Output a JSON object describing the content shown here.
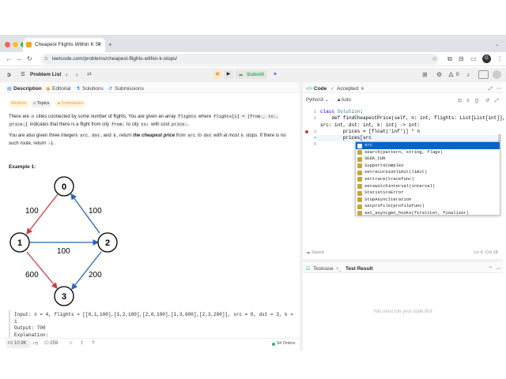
{
  "browser": {
    "tab_title": "Cheapest Flights Within K St",
    "url": "leetcode.com/problems/cheapest-flights-within-k-stops/",
    "profile": "G"
  },
  "nav": {
    "problem_list": "Problem List",
    "submit": "Submit",
    "streak": "0"
  },
  "left_tabs": {
    "description": "Description",
    "editorial": "Editorial",
    "solutions": "Solutions",
    "submissions": "Submissions"
  },
  "problem": {
    "difficulty": "Medium",
    "topics": "Topics",
    "companies": "Companies",
    "p1_a": "There are ",
    "p1_n": "n",
    "p1_b": " cities connected by some number of flights. You are given an array ",
    "p1_flights": "flights",
    "p1_c": " where ",
    "p1_fi": "flights[i] = [fromᵢ, toᵢ,",
    "p1_price": "priceᵢ]",
    "p1_d": " indicates that there is a flight from city ",
    "p1_from": "fromᵢ",
    "p1_e": " to city ",
    "p1_to": "toᵢ",
    "p1_f": " with cost ",
    "p1_cost": "priceᵢ",
    "p1_g": ".",
    "p2_a": "You are also given three integers ",
    "p2_src": "src",
    "p2_b": ", ",
    "p2_dst": "dst",
    "p2_c": ", and ",
    "p2_k": "k",
    "p2_d": ", return ",
    "p2_e": "the cheapest price",
    "p2_f": " from ",
    "p2_src2": "src",
    "p2_g": " to ",
    "p2_dst2": "dst",
    "p2_h": " with at most ",
    "p2_k2": "k",
    "p2_i": " stops.",
    "p2_j": " If there is no",
    "p2_k_line": "such route, return ",
    "p2_neg": "-1",
    "p2_end": ".",
    "example_title": "Example 1:",
    "input": "Input: n = 4, flights = [[0,1,100],[1,2,100],[2,0,100],[1,3,600],[2,3,200]], src = 0, dst = 3, k =",
    "input_cont": "1",
    "output": "Output: 700",
    "explanation": "Explanation:"
  },
  "graph": {
    "nodes": [
      "0",
      "1",
      "2",
      "3"
    ],
    "edge_labels": [
      "100",
      "100",
      "100",
      "600",
      "200"
    ]
  },
  "bottom_bar": {
    "likes": "10.9K",
    "comments": "259",
    "online": "94 Online"
  },
  "code_panel": {
    "code_tab": "Code",
    "accepted": "Accepted",
    "language": "Python3",
    "auto": "Auto",
    "lines": [
      {
        "n": "1",
        "text": "class Solution:"
      },
      {
        "n": "2",
        "text": "    def findCheapestPrice(self, n: int, flights: List[List[int]],"
      },
      {
        "n": "",
        "text": "src: int, dst: int, k: int) -> int:"
      },
      {
        "n": "3",
        "text": "        prices = [float('inf')] * n"
      },
      {
        "n": "4",
        "text": "        prices[src"
      },
      {
        "n": "5",
        "text": ""
      }
    ],
    "saved": "Saved",
    "cursor": "Ln 4, Col 18"
  },
  "autocomplete": [
    "src",
    "search(pattern, string, flags)",
    "SEEK_CUR",
    "SupportsComplex",
    "setrecursionlimit(limit)",
    "settrace(tracefunc)",
    "setswitchinterval(interval)",
    "StatisticsError",
    "StopAsyncIteration",
    "setprofile(profilefunc)",
    "set_asyncgen_hooks(firstiter, finalizer)"
  ],
  "test_panel": {
    "testcase": "Testcase",
    "test_result": "Test Result",
    "message": "You must run your code first"
  },
  "colors": {
    "red_edge": "#d13b3b",
    "blue_edge": "#2a64b4",
    "accent": "#0b63c9",
    "submit_green": "#2db55d"
  }
}
